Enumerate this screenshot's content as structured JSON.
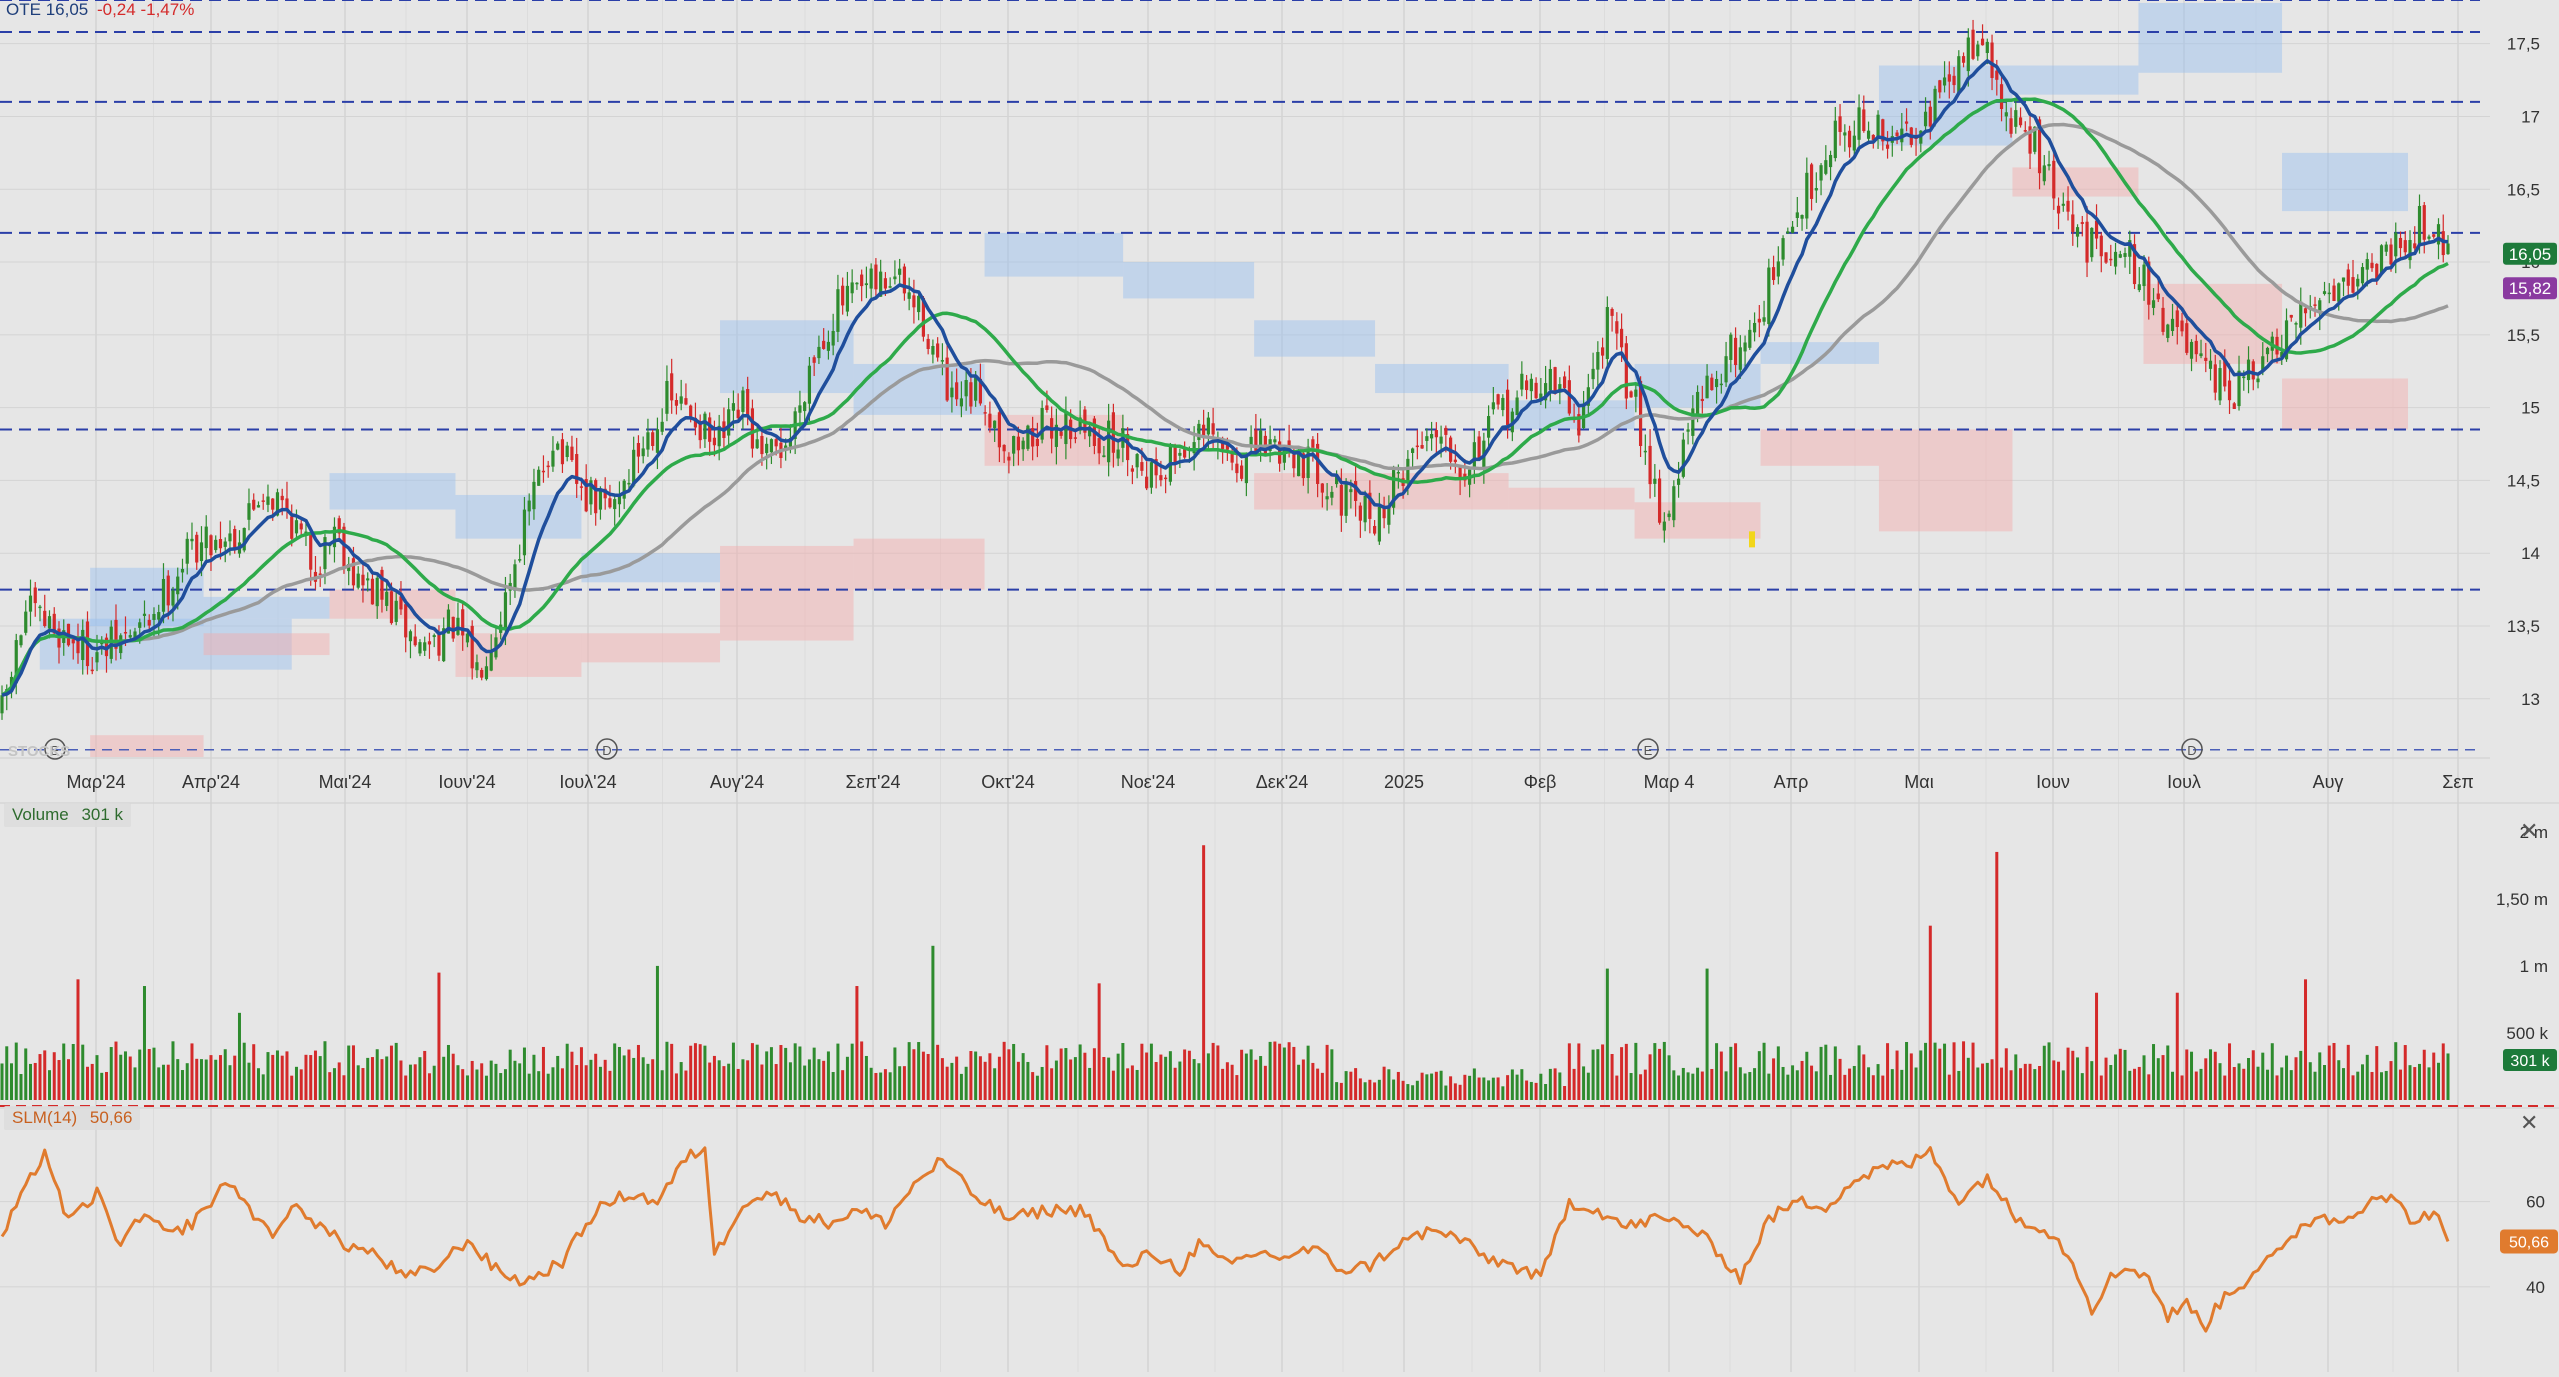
{
  "header": {
    "symbol": "OTE",
    "last": "16,05",
    "change": "-0,24",
    "change_pct": "-1,47%",
    "watermark": "STOCKS"
  },
  "volume_legend": {
    "label": "Volume",
    "value": "301 k"
  },
  "slm_legend": {
    "label": "SLM(14)",
    "value": "50,66"
  },
  "badges": {
    "price_current": "16,05",
    "price_ma": "15,82",
    "volume_current": "301 k",
    "slm_current": "50,66"
  },
  "markers": {
    "d_marker": "D",
    "e_marker": "E"
  },
  "chart_data": [
    {
      "type": "candlestick",
      "title": "",
      "x_ticks": [
        "Μαρ'24",
        "Απρ'24",
        "Μαι'24",
        "Ιουν'24",
        "Ιουλ'24",
        "Αυγ'24",
        "Σεπ'24",
        "Οκτ'24",
        "Νοε'24",
        "Δεκ'24",
        "2025",
        "Φεβ",
        "Μαρ 4",
        "Απρ",
        "Μαι",
        "Ιουν",
        "Ιουλ",
        "Αυγ",
        "Σεπ"
      ],
      "y_ticks": [
        "13",
        "13,5",
        "14",
        "14,5",
        "15",
        "15,5",
        "16",
        "16,5",
        "17",
        "17,5"
      ],
      "ylim": [
        12.6,
        17.8
      ],
      "horizontal_levels": [
        17.1,
        16.2,
        14.85,
        13.75
      ],
      "key_closes": [
        [
          0,
          12.9
        ],
        [
          5,
          13.6
        ],
        [
          10,
          13.5
        ],
        [
          20,
          13.3
        ],
        [
          30,
          13.5
        ],
        [
          40,
          14.05
        ],
        [
          50,
          14.15
        ],
        [
          55,
          14.45
        ],
        [
          60,
          14.3
        ],
        [
          66,
          13.9
        ],
        [
          70,
          14.2
        ],
        [
          75,
          13.8
        ],
        [
          80,
          13.7
        ],
        [
          88,
          13.35
        ],
        [
          95,
          13.5
        ],
        [
          100,
          13.2
        ],
        [
          105,
          13.6
        ],
        [
          110,
          14.2
        ],
        [
          116,
          14.8
        ],
        [
          122,
          14.4
        ],
        [
          128,
          14.3
        ],
        [
          134,
          14.7
        ],
        [
          140,
          15.05
        ],
        [
          146,
          14.95
        ],
        [
          150,
          14.7
        ],
        [
          156,
          15.0
        ],
        [
          160,
          14.6
        ],
        [
          166,
          14.8
        ],
        [
          170,
          15.3
        ],
        [
          176,
          15.7
        ],
        [
          182,
          15.8
        ],
        [
          188,
          15.9
        ],
        [
          194,
          15.6
        ],
        [
          200,
          15.0
        ],
        [
          206,
          15.1
        ],
        [
          212,
          14.7
        ],
        [
          218,
          14.85
        ],
        [
          224,
          14.9
        ],
        [
          230,
          14.8
        ],
        [
          236,
          14.75
        ],
        [
          242,
          14.55
        ],
        [
          248,
          14.7
        ],
        [
          254,
          14.8
        ],
        [
          260,
          14.6
        ],
        [
          266,
          14.75
        ],
        [
          272,
          14.7
        ],
        [
          278,
          14.55
        ],
        [
          284,
          14.3
        ],
        [
          290,
          14.25
        ],
        [
          296,
          14.65
        ],
        [
          302,
          14.9
        ],
        [
          308,
          14.6
        ],
        [
          314,
          14.9
        ],
        [
          320,
          15.1
        ],
        [
          326,
          15.2
        ],
        [
          332,
          14.9
        ],
        [
          338,
          15.6
        ],
        [
          344,
          15.0
        ],
        [
          350,
          14.2
        ],
        [
          356,
          14.95
        ],
        [
          362,
          15.3
        ],
        [
          368,
          15.5
        ],
        [
          374,
          16.0
        ],
        [
          380,
          16.5
        ],
        [
          386,
          16.9
        ],
        [
          392,
          16.95
        ],
        [
          398,
          16.8
        ],
        [
          404,
          17.0
        ],
        [
          410,
          17.2
        ],
        [
          416,
          17.6
        ],
        [
          422,
          17.0
        ],
        [
          428,
          16.8
        ],
        [
          434,
          16.3
        ],
        [
          440,
          16.1
        ],
        [
          446,
          16.15
        ],
        [
          452,
          15.8
        ],
        [
          458,
          15.5
        ],
        [
          464,
          15.2
        ],
        [
          470,
          15.1
        ],
        [
          476,
          15.3
        ],
        [
          482,
          15.5
        ],
        [
          488,
          15.8
        ],
        [
          494,
          15.9
        ],
        [
          500,
          16.0
        ],
        [
          506,
          16.2
        ],
        [
          512,
          16.3
        ],
        [
          515,
          16.05
        ]
      ],
      "ma_fast_color": "#1f4e9c",
      "ma_mid_color": "#2eaa4a",
      "ma_slow_color": "#9a9a9a",
      "up_color": "#2e8b2e",
      "down_color": "#d42a2a"
    },
    {
      "type": "bar",
      "title": "Volume",
      "y_ticks": [
        "500 k",
        "1 m",
        "1,50 m",
        "2 m"
      ],
      "ylim": [
        0,
        2200000
      ],
      "spikes": [
        [
          16,
          900000
        ],
        [
          30,
          850000
        ],
        [
          50,
          650000
        ],
        [
          92,
          950000
        ],
        [
          138,
          1000000
        ],
        [
          180,
          850000
        ],
        [
          196,
          1150000
        ],
        [
          231,
          870000
        ],
        [
          253,
          1900000
        ],
        [
          338,
          980000
        ],
        [
          359,
          980000
        ],
        [
          406,
          1300000
        ],
        [
          420,
          1850000
        ],
        [
          441,
          800000
        ],
        [
          458,
          800000
        ],
        [
          485,
          900000
        ]
      ]
    },
    {
      "type": "line",
      "title": "SLM(14)",
      "y_ticks": [
        "40",
        "60"
      ],
      "ylim": [
        20,
        82
      ],
      "key_values": [
        [
          0,
          52
        ],
        [
          5,
          63
        ],
        [
          9,
          72
        ],
        [
          14,
          55
        ],
        [
          20,
          62
        ],
        [
          25,
          50
        ],
        [
          30,
          57
        ],
        [
          35,
          52
        ],
        [
          40,
          55
        ],
        [
          48,
          65
        ],
        [
          52,
          58
        ],
        [
          58,
          52
        ],
        [
          62,
          60
        ],
        [
          66,
          55
        ],
        [
          72,
          50
        ],
        [
          78,
          48
        ],
        [
          85,
          42
        ],
        [
          92,
          45
        ],
        [
          98,
          51
        ],
        [
          104,
          44
        ],
        [
          110,
          41
        ],
        [
          118,
          46
        ],
        [
          125,
          58
        ],
        [
          132,
          62
        ],
        [
          138,
          60
        ],
        [
          144,
          70
        ],
        [
          148,
          73
        ],
        [
          150,
          47
        ],
        [
          156,
          60
        ],
        [
          162,
          62
        ],
        [
          168,
          57
        ],
        [
          174,
          55
        ],
        [
          180,
          58
        ],
        [
          186,
          55
        ],
        [
          192,
          64
        ],
        [
          198,
          70
        ],
        [
          204,
          62
        ],
        [
          212,
          56
        ],
        [
          220,
          58
        ],
        [
          228,
          58
        ],
        [
          236,
          44
        ],
        [
          242,
          48
        ],
        [
          248,
          44
        ],
        [
          252,
          50
        ],
        [
          258,
          45
        ],
        [
          264,
          48
        ],
        [
          270,
          47
        ],
        [
          276,
          49
        ],
        [
          282,
          44
        ],
        [
          288,
          45
        ],
        [
          294,
          50
        ],
        [
          300,
          53
        ],
        [
          306,
          52
        ],
        [
          312,
          47
        ],
        [
          318,
          45
        ],
        [
          324,
          42
        ],
        [
          330,
          60
        ],
        [
          336,
          58
        ],
        [
          342,
          54
        ],
        [
          348,
          56
        ],
        [
          354,
          55
        ],
        [
          360,
          50
        ],
        [
          366,
          42
        ],
        [
          372,
          56
        ],
        [
          378,
          60
        ],
        [
          384,
          59
        ],
        [
          390,
          65
        ],
        [
          396,
          68
        ],
        [
          402,
          69
        ],
        [
          406,
          72
        ],
        [
          412,
          60
        ],
        [
          418,
          66
        ],
        [
          424,
          56
        ],
        [
          428,
          55
        ],
        [
          432,
          52
        ],
        [
          436,
          46
        ],
        [
          440,
          35
        ],
        [
          444,
          42
        ],
        [
          448,
          45
        ],
        [
          452,
          42
        ],
        [
          456,
          33
        ],
        [
          460,
          36
        ],
        [
          464,
          31
        ],
        [
          468,
          38
        ],
        [
          472,
          41
        ],
        [
          476,
          46
        ],
        [
          480,
          48
        ],
        [
          484,
          54
        ],
        [
          488,
          57
        ],
        [
          492,
          55
        ],
        [
          496,
          58
        ],
        [
          500,
          62
        ],
        [
          504,
          60
        ],
        [
          508,
          55
        ],
        [
          512,
          58
        ],
        [
          515,
          50.66
        ]
      ],
      "line_color": "#e07b2e"
    }
  ]
}
